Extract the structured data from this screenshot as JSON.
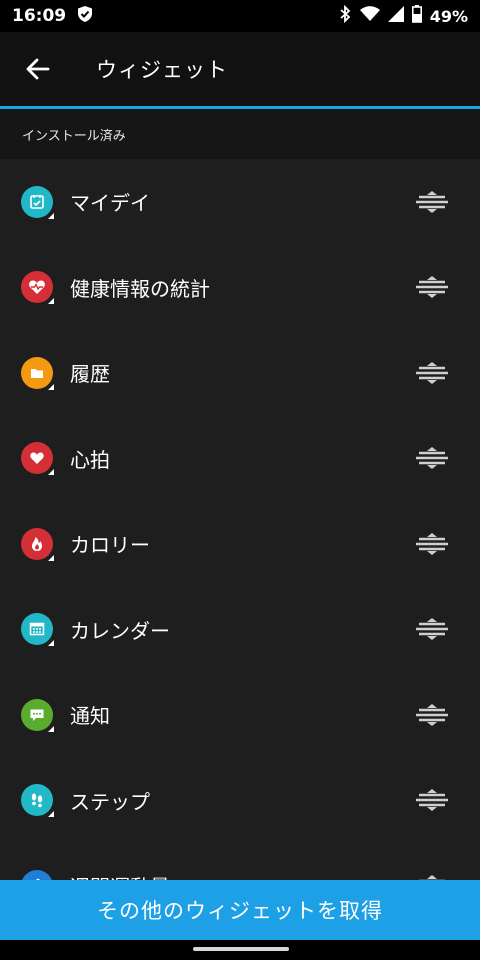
{
  "status": {
    "time": "16:09",
    "battery": "49%"
  },
  "header": {
    "title": "ウィジェット"
  },
  "section": {
    "label": "インストール済み"
  },
  "widgets": [
    {
      "label": "マイデイ",
      "icon": "my-day-icon",
      "color": "#22b8c7"
    },
    {
      "label": "健康情報の統計",
      "icon": "heart-rate-stats-icon",
      "color": "#d42f36"
    },
    {
      "label": "履歴",
      "icon": "history-icon",
      "color": "#f39a12"
    },
    {
      "label": "心拍",
      "icon": "heart-icon",
      "color": "#d42f36"
    },
    {
      "label": "カロリー",
      "icon": "flame-icon",
      "color": "#d42f36"
    },
    {
      "label": "カレンダー",
      "icon": "calendar-icon",
      "color": "#22b8c7"
    },
    {
      "label": "通知",
      "icon": "chat-bubble-icon",
      "color": "#5aac2e"
    },
    {
      "label": "ステップ",
      "icon": "footsteps-icon",
      "color": "#22b8c7"
    },
    {
      "label": "週間運動量",
      "icon": "running-icon",
      "color": "#1e7fd8"
    }
  ],
  "footer": {
    "button_label": "その他のウィジェットを取得"
  },
  "colors": {
    "accent": "#1ea0e6"
  }
}
